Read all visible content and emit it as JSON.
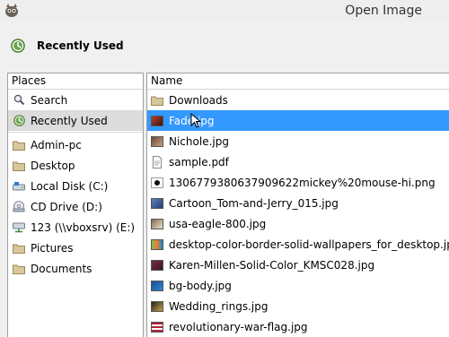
{
  "window": {
    "title": "Open Image"
  },
  "header": {
    "title": "Recently Used"
  },
  "places": {
    "heading": "Places",
    "items": [
      {
        "label": "Search",
        "icon": "search-icon"
      },
      {
        "label": "Recently Used",
        "icon": "recent-icon",
        "selected": true
      },
      {
        "label": "Admin-pc",
        "icon": "folder-icon"
      },
      {
        "label": "Desktop",
        "icon": "folder-icon"
      },
      {
        "label": "Local Disk (C:)",
        "icon": "drive-icon"
      },
      {
        "label": "CD Drive (D:)",
        "icon": "cd-icon"
      },
      {
        "label": "123 (\\\\vboxsrv) (E:)",
        "icon": "network-drive-icon"
      },
      {
        "label": "Pictures",
        "icon": "folder-icon"
      },
      {
        "label": "Documents",
        "icon": "folder-icon"
      }
    ]
  },
  "files": {
    "column_header": "Name",
    "items": [
      {
        "label": "Downloads",
        "icon": "folder-icon"
      },
      {
        "label": "Fade.jpg",
        "icon": "image-thumb-icon",
        "selected": true
      },
      {
        "label": "Nichole.jpg",
        "icon": "image-thumb-icon"
      },
      {
        "label": "sample.pdf",
        "icon": "pdf-file-icon"
      },
      {
        "label": "1306779380637909622mickey%20mouse-hi.png",
        "icon": "image-thumb-icon"
      },
      {
        "label": "Cartoon_Tom-and-Jerry_015.jpg",
        "icon": "image-thumb-icon"
      },
      {
        "label": "usa-eagle-800.jpg",
        "icon": "image-thumb-icon"
      },
      {
        "label": "desktop-color-border-solid-wallpapers_for_desktop.jpg",
        "icon": "image-thumb-icon"
      },
      {
        "label": "Karen-Millen-Solid-Color_KMSC028.jpg",
        "icon": "image-thumb-icon"
      },
      {
        "label": "bg-body.jpg",
        "icon": "image-thumb-icon"
      },
      {
        "label": "Wedding_rings.jpg",
        "icon": "image-thumb-icon"
      },
      {
        "label": "revolutionary-war-flag.jpg",
        "icon": "image-thumb-icon"
      }
    ]
  },
  "colors": {
    "selection": "#3399ff",
    "places_selection": "#dcdcdc",
    "folder": "#d8c79a"
  }
}
